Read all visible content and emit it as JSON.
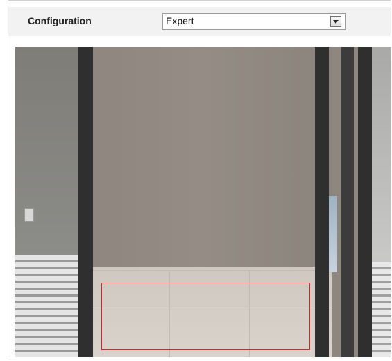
{
  "configuration": {
    "label": "Configuration",
    "mode_select": {
      "value": "Expert"
    }
  },
  "colors": {
    "header_bg": "#f2f2f2",
    "region_border": "#e02020"
  }
}
